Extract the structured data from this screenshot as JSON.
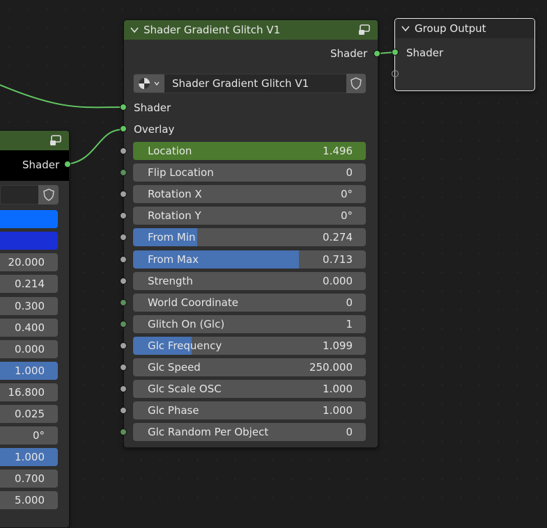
{
  "shader_node": {
    "title": "Shader Gradient Glitch V1",
    "output_label": "Shader",
    "datablock_name": "Shader Gradient Glitch V1",
    "inputs": [
      {
        "label": "Shader"
      },
      {
        "label": "Overlay"
      }
    ],
    "params": [
      {
        "label": "Location",
        "value": "1.496",
        "fill": 1.0,
        "style": "green"
      },
      {
        "label": "Flip Location",
        "value": "0",
        "fill": 0
      },
      {
        "label": "Rotation X",
        "value": "0°",
        "fill": 0
      },
      {
        "label": "Rotation Y",
        "value": "0°",
        "fill": 0
      },
      {
        "label": "From Min",
        "value": "0.274",
        "fill": 0.274
      },
      {
        "label": "From Max",
        "value": "0.713",
        "fill": 0.713
      },
      {
        "label": "Strength",
        "value": "0.000",
        "fill": 0
      },
      {
        "label": "World Coordinate",
        "value": "0",
        "fill": 0
      },
      {
        "label": "Glitch On (Glc)",
        "value": "1",
        "fill": 0
      },
      {
        "label": "Glc Frequency",
        "value": "1.099",
        "fill": 0.25
      },
      {
        "label": "Glc Speed",
        "value": "250.000",
        "fill": 0
      },
      {
        "label": "Glc Scale OSC",
        "value": "1.000",
        "fill": 0
      },
      {
        "label": "Glc Phase",
        "value": "1.000",
        "fill": 0
      },
      {
        "label": "Glc Random Per Object",
        "value": "0",
        "fill": 0
      }
    ]
  },
  "group_output": {
    "title": "Group Output",
    "input_label": "Shader"
  },
  "left_node": {
    "output_label": "Shader",
    "values": [
      "20.000",
      "0.214",
      "0.300",
      "0.400",
      "0.000",
      "1.000",
      "16.800",
      "0.025",
      "0°",
      "1.000",
      "0.700",
      "5.000"
    ],
    "colors": {
      "color_a": "#0a6cff",
      "color_b": "#1a2fd6"
    }
  },
  "colors": {
    "background": "#1d1d1d",
    "node_body": "#2f2f2f",
    "header_green": "#3b5a2c",
    "socket_green": "#63c763",
    "field": "#545454",
    "slider_blue": "#4772b3"
  }
}
